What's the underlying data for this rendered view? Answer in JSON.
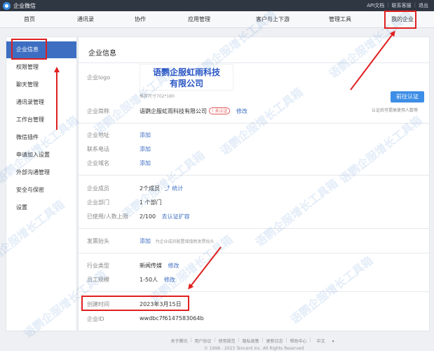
{
  "app": {
    "name": "企业微信"
  },
  "toplinks": [
    "API文档",
    "联系客服",
    "退出"
  ],
  "nav": [
    "首页",
    "通讯录",
    "协作",
    "应用管理",
    "客户与上下游",
    "管理工具",
    "我的企业"
  ],
  "sidebar": [
    "企业信息",
    "权限管理",
    "聊天管理",
    "通讯录管理",
    "工作台管理",
    "微信插件",
    "申请加入设置",
    "外部沟通管理",
    "安全与保密",
    "设置"
  ],
  "main": {
    "title": "企业信息",
    "logo": {
      "label": "企业logo",
      "line1": "语鹦企服虹雨科技",
      "line2": "有限公司",
      "hint": "推荐尺寸702*180"
    },
    "name": {
      "label": "企业简称",
      "value": "语鹦企服虹雨科技有限公司",
      "badge": "未认证",
      "edit": "修改"
    },
    "verify": {
      "button": "前往认证",
      "hint": "认证后可提高使用人数等"
    },
    "address": {
      "label": "企业地址",
      "action": "添加"
    },
    "phone": {
      "label": "联系电话",
      "action": "添加"
    },
    "domain": {
      "label": "企业域名",
      "action": "添加"
    },
    "members": {
      "label": "企业成员",
      "value": "2个成员",
      "link": "统计"
    },
    "departments": {
      "label": "企业部门",
      "value": "1 个部门"
    },
    "usage": {
      "label": "已使用/人数上限",
      "value": "2/100",
      "link": "去认证扩容"
    },
    "invoice": {
      "label": "发票抬头",
      "action": "添加",
      "hint": "为企业成员配置增值税发票抬头"
    },
    "industry": {
      "label": "行业类型",
      "value": "新闻传媒",
      "edit": "修改"
    },
    "scale": {
      "label": "员工规模",
      "value": "1-50人",
      "edit": "修改"
    },
    "created": {
      "label": "创建时间",
      "value": "2023年3月15日"
    },
    "corpid": {
      "label": "企业ID",
      "value": "wwdbc7f6147583064b"
    }
  },
  "footer": {
    "links": [
      "关于腾讯",
      "用户协议",
      "使用规范",
      "隐私政策",
      "更新日志",
      "帮助中心",
      "中文"
    ],
    "copyright": "© 1998 - 2023 Tencent Inc. All Rights Reserved"
  },
  "watermark": "语鹦企服增长工具箱",
  "colors": {
    "accent": "#3d6ec2",
    "annotation": "#e02020",
    "topbar": "#2f3743"
  }
}
